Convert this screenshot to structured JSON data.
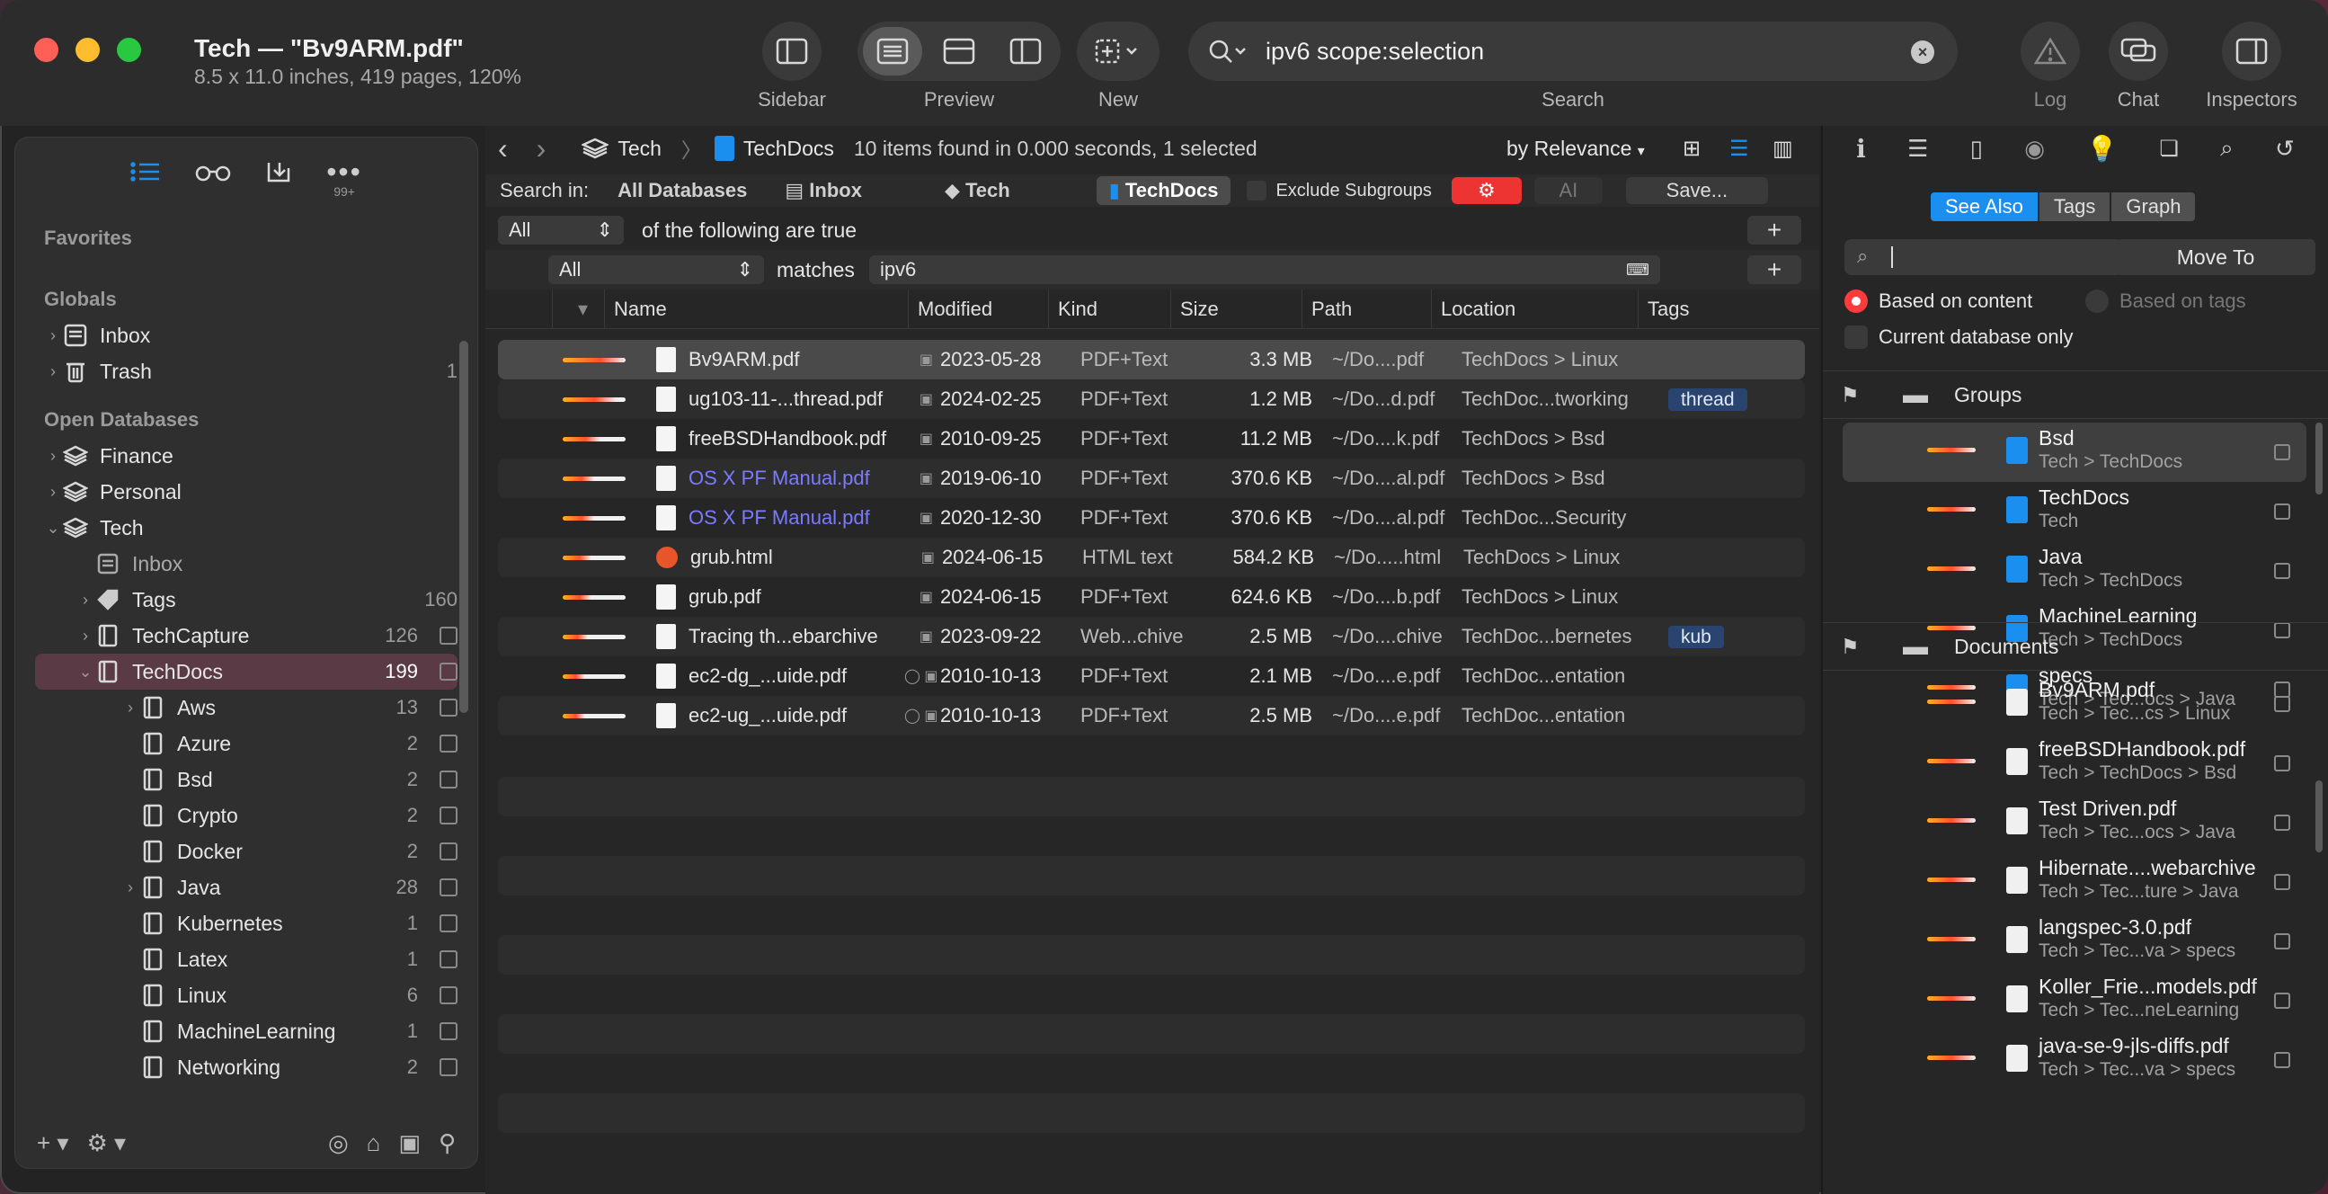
{
  "window": {
    "title": "Tech — \"Bv9ARM.pdf\"",
    "subtitle": "8.5 x 11.0 inches, 419 pages, 120%"
  },
  "toolbar": {
    "sidebar_label": "Sidebar",
    "preview_label": "Preview",
    "new_label": "New",
    "search_label": "Search",
    "search_query": "ipv6  scope:selection",
    "log_label": "Log",
    "chat_label": "Chat",
    "inspectors_label": "Inspectors"
  },
  "sidebar": {
    "badge": "99+",
    "favorites": "Favorites",
    "globals": "Globals",
    "inbox": "Inbox",
    "trash": "Trash",
    "trash_count": "1",
    "open_databases": "Open Databases",
    "db_finance": "Finance",
    "db_personal": "Personal",
    "db_tech": "Tech",
    "tech_inbox": "Inbox",
    "tags": "Tags",
    "tags_count": "160",
    "techcapture": "TechCapture",
    "techcapture_count": "126",
    "techdocs": "TechDocs",
    "techdocs_count": "199",
    "groups": [
      {
        "name": "Aws",
        "count": "13",
        "disclosure": true
      },
      {
        "name": "Azure",
        "count": "2",
        "disclosure": false
      },
      {
        "name": "Bsd",
        "count": "2",
        "disclosure": false
      },
      {
        "name": "Crypto",
        "count": "2",
        "disclosure": false
      },
      {
        "name": "Docker",
        "count": "2",
        "disclosure": false
      },
      {
        "name": "Java",
        "count": "28",
        "disclosure": true
      },
      {
        "name": "Kubernetes",
        "count": "1",
        "disclosure": false
      },
      {
        "name": "Latex",
        "count": "1",
        "disclosure": false
      },
      {
        "name": "Linux",
        "count": "6",
        "disclosure": false
      },
      {
        "name": "MachineLearning",
        "count": "1",
        "disclosure": false
      },
      {
        "name": "Networking",
        "count": "2",
        "disclosure": false
      }
    ]
  },
  "nav": {
    "crumb_db": "Tech",
    "crumb_group": "TechDocs",
    "found": "10 items found in 0.000 seconds, 1 selected",
    "sort": "by Relevance"
  },
  "searchin": {
    "label": "Search in:",
    "all_databases": "All Databases",
    "inbox": "Inbox",
    "tech": "Tech",
    "techdocs": "TechDocs",
    "exclude": "Exclude Subgroups",
    "ai": "AI",
    "save": "Save..."
  },
  "criteria": {
    "all1": "All",
    "following": "of the following are true",
    "all2": "All",
    "matches": "matches",
    "term": "ipv6"
  },
  "columns": {
    "name": "Name",
    "modified": "Modified",
    "kind": "Kind",
    "size": "Size",
    "path": "Path",
    "location": "Location",
    "tags": "Tags"
  },
  "rows": [
    {
      "name": "Bv9ARM.pdf",
      "modified": "2023-05-28",
      "kind": "PDF+Text",
      "size": "3.3 MB",
      "path": "~/Do....pdf",
      "location": "TechDocs > Linux",
      "tag": "",
      "relevance": 1.0,
      "link": false
    },
    {
      "name": "ug103-11-...thread.pdf",
      "modified": "2024-02-25",
      "kind": "PDF+Text",
      "size": "1.2 MB",
      "path": "~/Do...d.pdf",
      "location": "TechDoc...tworking",
      "tag": "thread",
      "relevance": 0.85,
      "link": false
    },
    {
      "name": "freeBSDHandbook.pdf",
      "modified": "2010-09-25",
      "kind": "PDF+Text",
      "size": "11.2 MB",
      "path": "~/Do....k.pdf",
      "location": "TechDocs > Bsd",
      "tag": "",
      "relevance": 0.6,
      "link": false
    },
    {
      "name": "OS X PF Manual.pdf",
      "modified": "2019-06-10",
      "kind": "PDF+Text",
      "size": "370.6 KB",
      "path": "~/Do....al.pdf",
      "location": "TechDocs > Bsd",
      "tag": "",
      "relevance": 0.5,
      "link": true
    },
    {
      "name": "OS X PF Manual.pdf",
      "modified": "2020-12-30",
      "kind": "PDF+Text",
      "size": "370.6 KB",
      "path": "~/Do....al.pdf",
      "location": "TechDoc...Security",
      "tag": "",
      "relevance": 0.5,
      "link": true
    },
    {
      "name": "grub.html",
      "modified": "2024-06-15",
      "kind": "HTML text",
      "size": "584.2 KB",
      "path": "~/Do.....html",
      "location": "TechDocs > Linux",
      "tag": "",
      "relevance": 0.45,
      "link": false
    },
    {
      "name": "grub.pdf",
      "modified": "2024-06-15",
      "kind": "PDF+Text",
      "size": "624.6 KB",
      "path": "~/Do....b.pdf",
      "location": "TechDocs > Linux",
      "tag": "",
      "relevance": 0.45,
      "link": false
    },
    {
      "name": "Tracing th...ebarchive",
      "modified": "2023-09-22",
      "kind": "Web...chive",
      "size": "2.5 MB",
      "path": "~/Do....chive",
      "location": "TechDoc...bernetes",
      "tag": "kub",
      "relevance": 0.4,
      "link": false
    },
    {
      "name": "ec2-dg_...uide.pdf",
      "modified": "2010-10-13",
      "kind": "PDF+Text",
      "size": "2.1 MB",
      "path": "~/Do....e.pdf",
      "location": "TechDoc...entation",
      "tag": "",
      "relevance": 0.35,
      "link": false
    },
    {
      "name": "ec2-ug_...uide.pdf",
      "modified": "2010-10-13",
      "kind": "PDF+Text",
      "size": "2.5 MB",
      "path": "~/Do....e.pdf",
      "location": "TechDoc...entation",
      "tag": "",
      "relevance": 0.35,
      "link": false
    }
  ],
  "inspector": {
    "see_also": "See Also",
    "tags": "Tags",
    "graph": "Graph",
    "move_to": "Move To",
    "based_on_content": "Based on content",
    "based_on_tags": "Based on tags",
    "current_db_only": "Current database only",
    "groups_header": "Groups",
    "groups": [
      {
        "name": "Bsd",
        "path": "Tech > TechDocs"
      },
      {
        "name": "TechDocs",
        "path": "Tech"
      },
      {
        "name": "Java",
        "path": "Tech > TechDocs"
      },
      {
        "name": "MachineLearning",
        "path": "Tech > TechDocs"
      },
      {
        "name": "specs",
        "path": "Tech > Tec...ocs > Java"
      }
    ],
    "documents_header": "Documents",
    "documents": [
      {
        "name": "Bv9ARM.pdf",
        "path": "Tech > Tec...cs > Linux"
      },
      {
        "name": "freeBSDHandbook.pdf",
        "path": "Tech > TechDocs > Bsd"
      },
      {
        "name": "Test Driven.pdf",
        "path": "Tech > Tec...ocs > Java"
      },
      {
        "name": "Hibernate....webarchive",
        "path": "Tech > Tec...ture > Java"
      },
      {
        "name": "langspec-3.0.pdf",
        "path": "Tech > Tec...va > specs"
      },
      {
        "name": "Koller_Frie...models.pdf",
        "path": "Tech > Tec...neLearning"
      },
      {
        "name": "java-se-9-jls-diffs.pdf",
        "path": "Tech > Tec...va > specs"
      }
    ]
  },
  "colors": {
    "accent": "#1a8ff0",
    "selection": "#5a3a44",
    "tag_chip": "#2a4470",
    "link": "#7b7bff",
    "close": "#fe5f57",
    "minimize": "#febc2e",
    "zoom": "#28c840"
  }
}
